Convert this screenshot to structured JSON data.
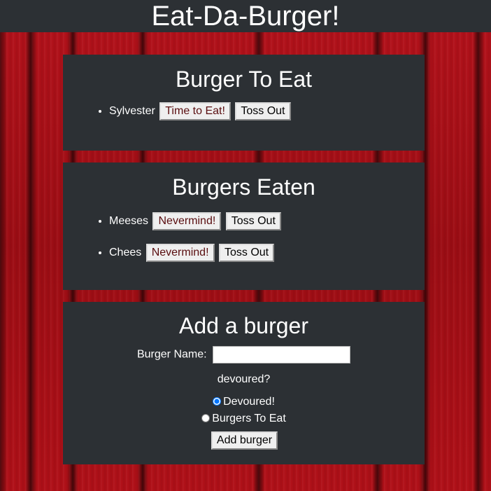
{
  "header": {
    "title": "Eat-Da-Burger!"
  },
  "to_eat": {
    "title": "Burger To Eat",
    "items": [
      {
        "name": "Sylvester",
        "action_label": "Time to Eat!",
        "remove_label": "Toss Out"
      }
    ]
  },
  "eaten": {
    "title": "Burgers Eaten",
    "items": [
      {
        "name": "Meeses",
        "action_label": "Nevermind!",
        "remove_label": "Toss Out"
      },
      {
        "name": "Chees",
        "action_label": "Nevermind!",
        "remove_label": "Toss Out"
      }
    ]
  },
  "add_form": {
    "title": "Add a burger",
    "name_label": "Burger Name:",
    "name_value": "",
    "devoured_question": "devoured?",
    "options": [
      {
        "label": "Devoured!",
        "checked": true
      },
      {
        "label": "Burgers To Eat",
        "checked": false
      }
    ],
    "submit_label": "Add burger"
  },
  "colors": {
    "panel_bg": "#2c3034",
    "background": "#b5121b"
  }
}
